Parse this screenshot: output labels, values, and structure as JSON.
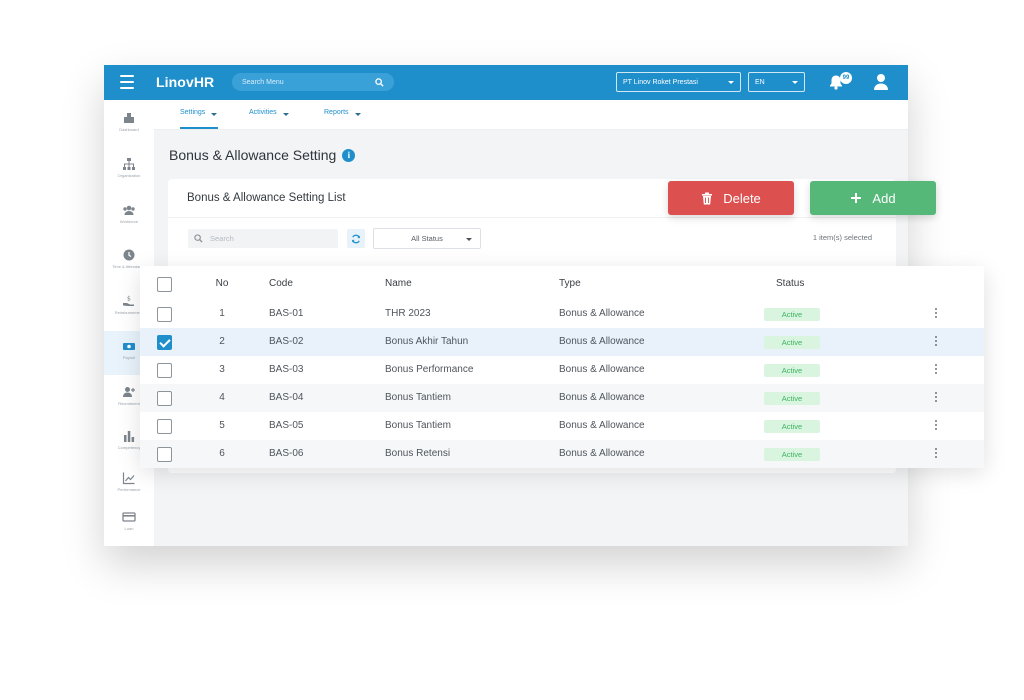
{
  "app": {
    "logo_prefix": "Linov",
    "logo_suffix": "HR",
    "search_placeholder": "Search Menu",
    "company": "PT Linov Roket Prestasi",
    "language": "EN",
    "notification_count": "99"
  },
  "sidebar": {
    "items": [
      {
        "label": "Dashboard",
        "icon": "dashboard-icon"
      },
      {
        "label": "Organization",
        "icon": "org-chart-icon"
      },
      {
        "label": "Workforce",
        "icon": "people-icon"
      },
      {
        "label": "Time & Attendance",
        "icon": "clock-icon"
      },
      {
        "label": "Reimbursement",
        "icon": "hand-money-icon"
      },
      {
        "label": "Payroll",
        "icon": "payroll-icon"
      },
      {
        "label": "Recruitment",
        "icon": "add-user-icon"
      },
      {
        "label": "Competency",
        "icon": "bar-chart-icon"
      },
      {
        "label": "Performance",
        "icon": "trend-icon"
      },
      {
        "label": "Loan",
        "icon": "card-icon"
      }
    ]
  },
  "subnav": {
    "tabs": [
      {
        "label": "Settings"
      },
      {
        "label": "Activities"
      },
      {
        "label": "Reports"
      }
    ]
  },
  "page": {
    "title": "Bonus & Allowance Setting"
  },
  "card": {
    "title": "Bonus & Allowance Setting List",
    "search_placeholder": "Search",
    "status_filter": "All Status",
    "selected_count": "1 item(s) selected"
  },
  "actions": {
    "delete_label": "Delete",
    "add_label": "Add"
  },
  "colors": {
    "primary": "#1f8fcc",
    "delete": "#dc5050",
    "add": "#56b878",
    "active_badge_bg": "#d9f5e0",
    "active_badge_text": "#3cb460"
  },
  "table": {
    "headers": {
      "no": "No",
      "code": "Code",
      "name": "Name",
      "type": "Type",
      "status": "Status"
    },
    "rows": [
      {
        "no": "1",
        "code": "BAS-01",
        "name": "THR 2023",
        "type": "Bonus & Allowance",
        "status": "Active",
        "checked": false
      },
      {
        "no": "2",
        "code": "BAS-02",
        "name": "Bonus Akhir Tahun",
        "type": "Bonus & Allowance",
        "status": "Active",
        "checked": true
      },
      {
        "no": "3",
        "code": "BAS-03",
        "name": "Bonus Performance",
        "type": "Bonus & Allowance",
        "status": "Active",
        "checked": false
      },
      {
        "no": "4",
        "code": "BAS-04",
        "name": "Bonus Tantiem",
        "type": "Bonus & Allowance",
        "status": "Active",
        "checked": false
      },
      {
        "no": "5",
        "code": "BAS-05",
        "name": "Bonus Tantiem",
        "type": "Bonus & Allowance",
        "status": "Active",
        "checked": false
      },
      {
        "no": "6",
        "code": "BAS-06",
        "name": "Bonus Retensi",
        "type": "Bonus & Allowance",
        "status": "Active",
        "checked": false
      }
    ]
  }
}
